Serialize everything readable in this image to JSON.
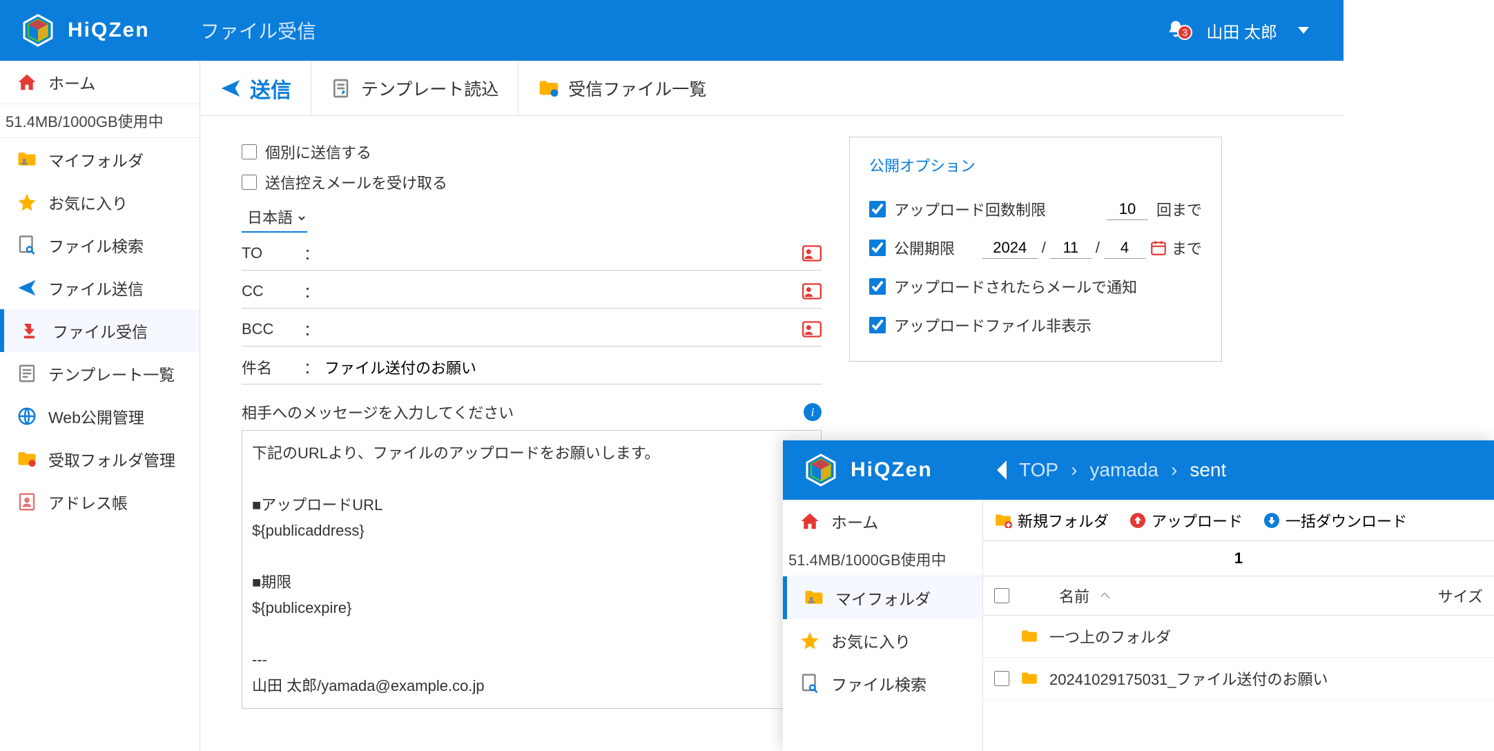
{
  "header": {
    "logo": "HiQZen",
    "page_title": "ファイル受信",
    "notification_count": "3",
    "user_name": "山田 太郎"
  },
  "sidebar": {
    "home": "ホーム",
    "storage": "51.4MB/1000GB使用中",
    "items": [
      {
        "label": "マイフォルダ"
      },
      {
        "label": "お気に入り"
      },
      {
        "label": "ファイル検索"
      },
      {
        "label": "ファイル送信"
      },
      {
        "label": "ファイル受信"
      },
      {
        "label": "テンプレート一覧"
      },
      {
        "label": "Web公開管理"
      },
      {
        "label": "受取フォルダ管理"
      },
      {
        "label": "アドレス帳"
      }
    ]
  },
  "toolbar": {
    "send": "送信",
    "template_load": "テンプレート読込",
    "recv_list": "受信ファイル一覧"
  },
  "form": {
    "individual_send": "個別に送信する",
    "copy_self": "送信控えメールを受け取る",
    "language": "日本語",
    "to_label": "TO",
    "cc_label": "CC",
    "bcc_label": "BCC",
    "subject_label": "件名",
    "subject_value": "ファイル送付のお願い",
    "msg_label": "相手へのメッセージを入力してください",
    "msg_body": "下記のURLより、ファイルのアップロードをお願いします。\n\n■アップロードURL\n  ${publicaddress}\n\n■期限\n  ${publicexpire}\n\n---\n山田 太郎/yamada@example.co.jp"
  },
  "options": {
    "title": "公開オプション",
    "upload_limit_label": "アップロード回数制限",
    "upload_limit_value": "10",
    "upload_limit_suffix": "回まで",
    "expiry_label": "公開期限",
    "expiry_year": "2024",
    "expiry_month": "11",
    "expiry_day": "4",
    "expiry_suffix": "まで",
    "notify_label": "アップロードされたらメールで通知",
    "hide_label": "アップロードファイル非表示"
  },
  "second": {
    "breadcrumb": [
      "TOP",
      "yamada",
      "sent"
    ],
    "toolbar": {
      "new_folder": "新規フォルダ",
      "upload": "アップロード",
      "download_all": "一括ダウンロード"
    },
    "page": "1",
    "col_name": "名前",
    "col_size": "サイズ",
    "rows": [
      {
        "name": "一つ上のフォルダ"
      },
      {
        "name": "20241029175031_ファイル送付のお願い"
      }
    ],
    "sidebar": {
      "home": "ホーム",
      "storage": "51.4MB/1000GB使用中",
      "items": [
        {
          "label": "マイフォルダ"
        },
        {
          "label": "お気に入り"
        },
        {
          "label": "ファイル検索"
        }
      ]
    }
  }
}
